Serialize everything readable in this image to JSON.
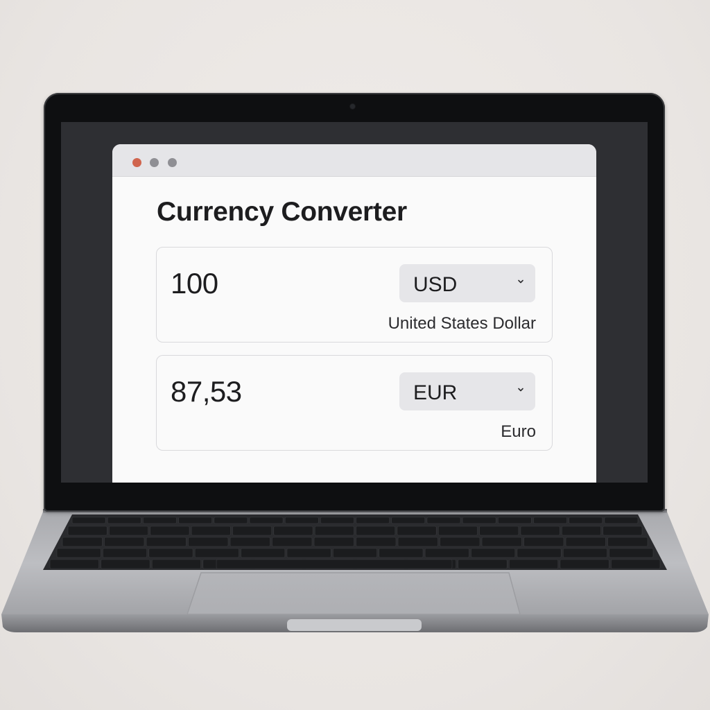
{
  "app": {
    "title": "Currency Converter"
  },
  "window": {
    "controls": [
      "close",
      "minimize",
      "maximize"
    ],
    "colors": {
      "close": "#d0654e",
      "inactive": "#8f8f94"
    }
  },
  "converter": {
    "from": {
      "amount": "100",
      "currency_code": "USD",
      "currency_name": "United States Dollar"
    },
    "to": {
      "amount": "87,53",
      "currency_code": "EUR",
      "currency_name": "Euro"
    }
  },
  "icons": {
    "dropdown": "chevron-down-icon"
  }
}
